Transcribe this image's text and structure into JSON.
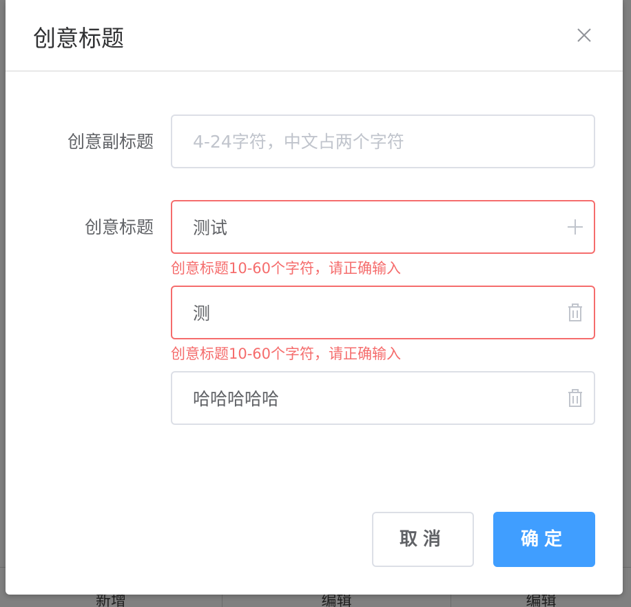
{
  "background": {
    "cells": [
      "新增",
      "编辑",
      "编辑"
    ]
  },
  "dialog": {
    "title": "创意标题",
    "close_icon": "close-icon"
  },
  "form": {
    "subtitle": {
      "label": "创意副标题",
      "value": "",
      "placeholder": "4-24字符，中文占两个字符"
    },
    "titles": {
      "label": "创意标题",
      "items": [
        {
          "value": "测试",
          "icon": "plus-icon",
          "error": "创意标题10-60个字符，请正确输入"
        },
        {
          "value": "测",
          "icon": "trash-icon",
          "error": "创意标题10-60个字符，请正确输入"
        },
        {
          "value": "哈哈哈哈哈",
          "icon": "trash-icon",
          "error": ""
        }
      ]
    }
  },
  "footer": {
    "cancel_label": "取消",
    "confirm_label": "确定"
  },
  "colors": {
    "primary": "#409eff",
    "error": "#f56c6c",
    "border": "#dcdfe6",
    "text": "#606266",
    "placeholder": "#c0c4cc"
  }
}
